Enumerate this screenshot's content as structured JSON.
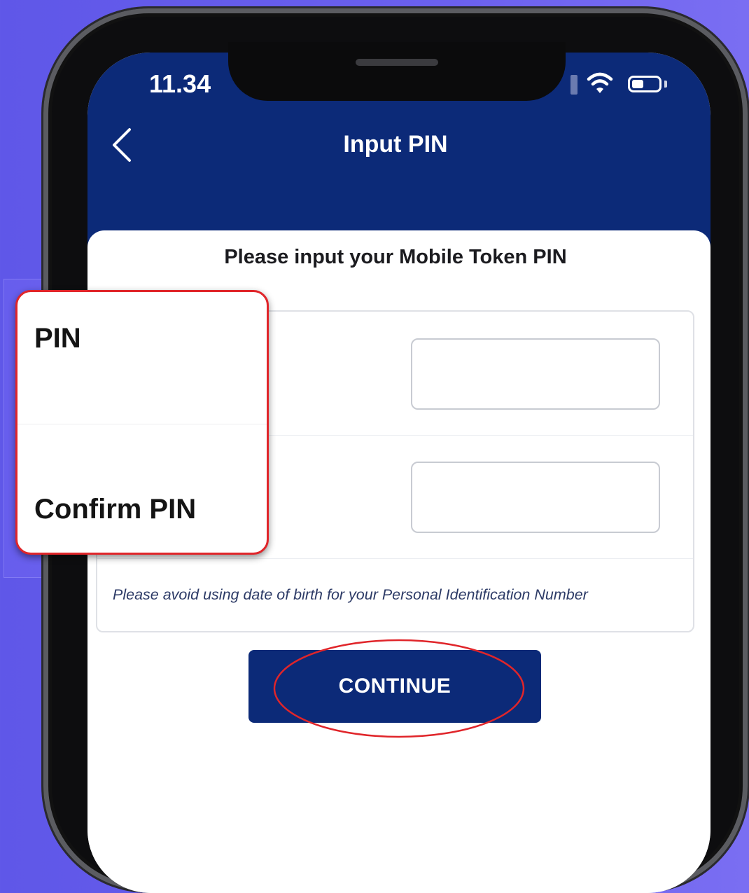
{
  "status_bar": {
    "time": "11.34"
  },
  "header": {
    "title": "Input PIN"
  },
  "form": {
    "instruction": "Please input your Mobile Token PIN",
    "pin_label": "PIN",
    "confirm_label": "Confirm PIN",
    "pin_value": "",
    "confirm_value": "",
    "hint": "Please avoid using date of birth for your Personal Identification Number"
  },
  "actions": {
    "continue_label": "CONTINUE"
  },
  "icons": {
    "back": "chevron-left-icon",
    "signal": "signal-icon",
    "wifi": "wifi-icon",
    "battery": "battery-icon"
  },
  "colors": {
    "header_bg": "#0c2a78",
    "button_bg": "#0c2a78",
    "annotation_red": "#e0252a",
    "page_bg": "#6b60ee"
  }
}
